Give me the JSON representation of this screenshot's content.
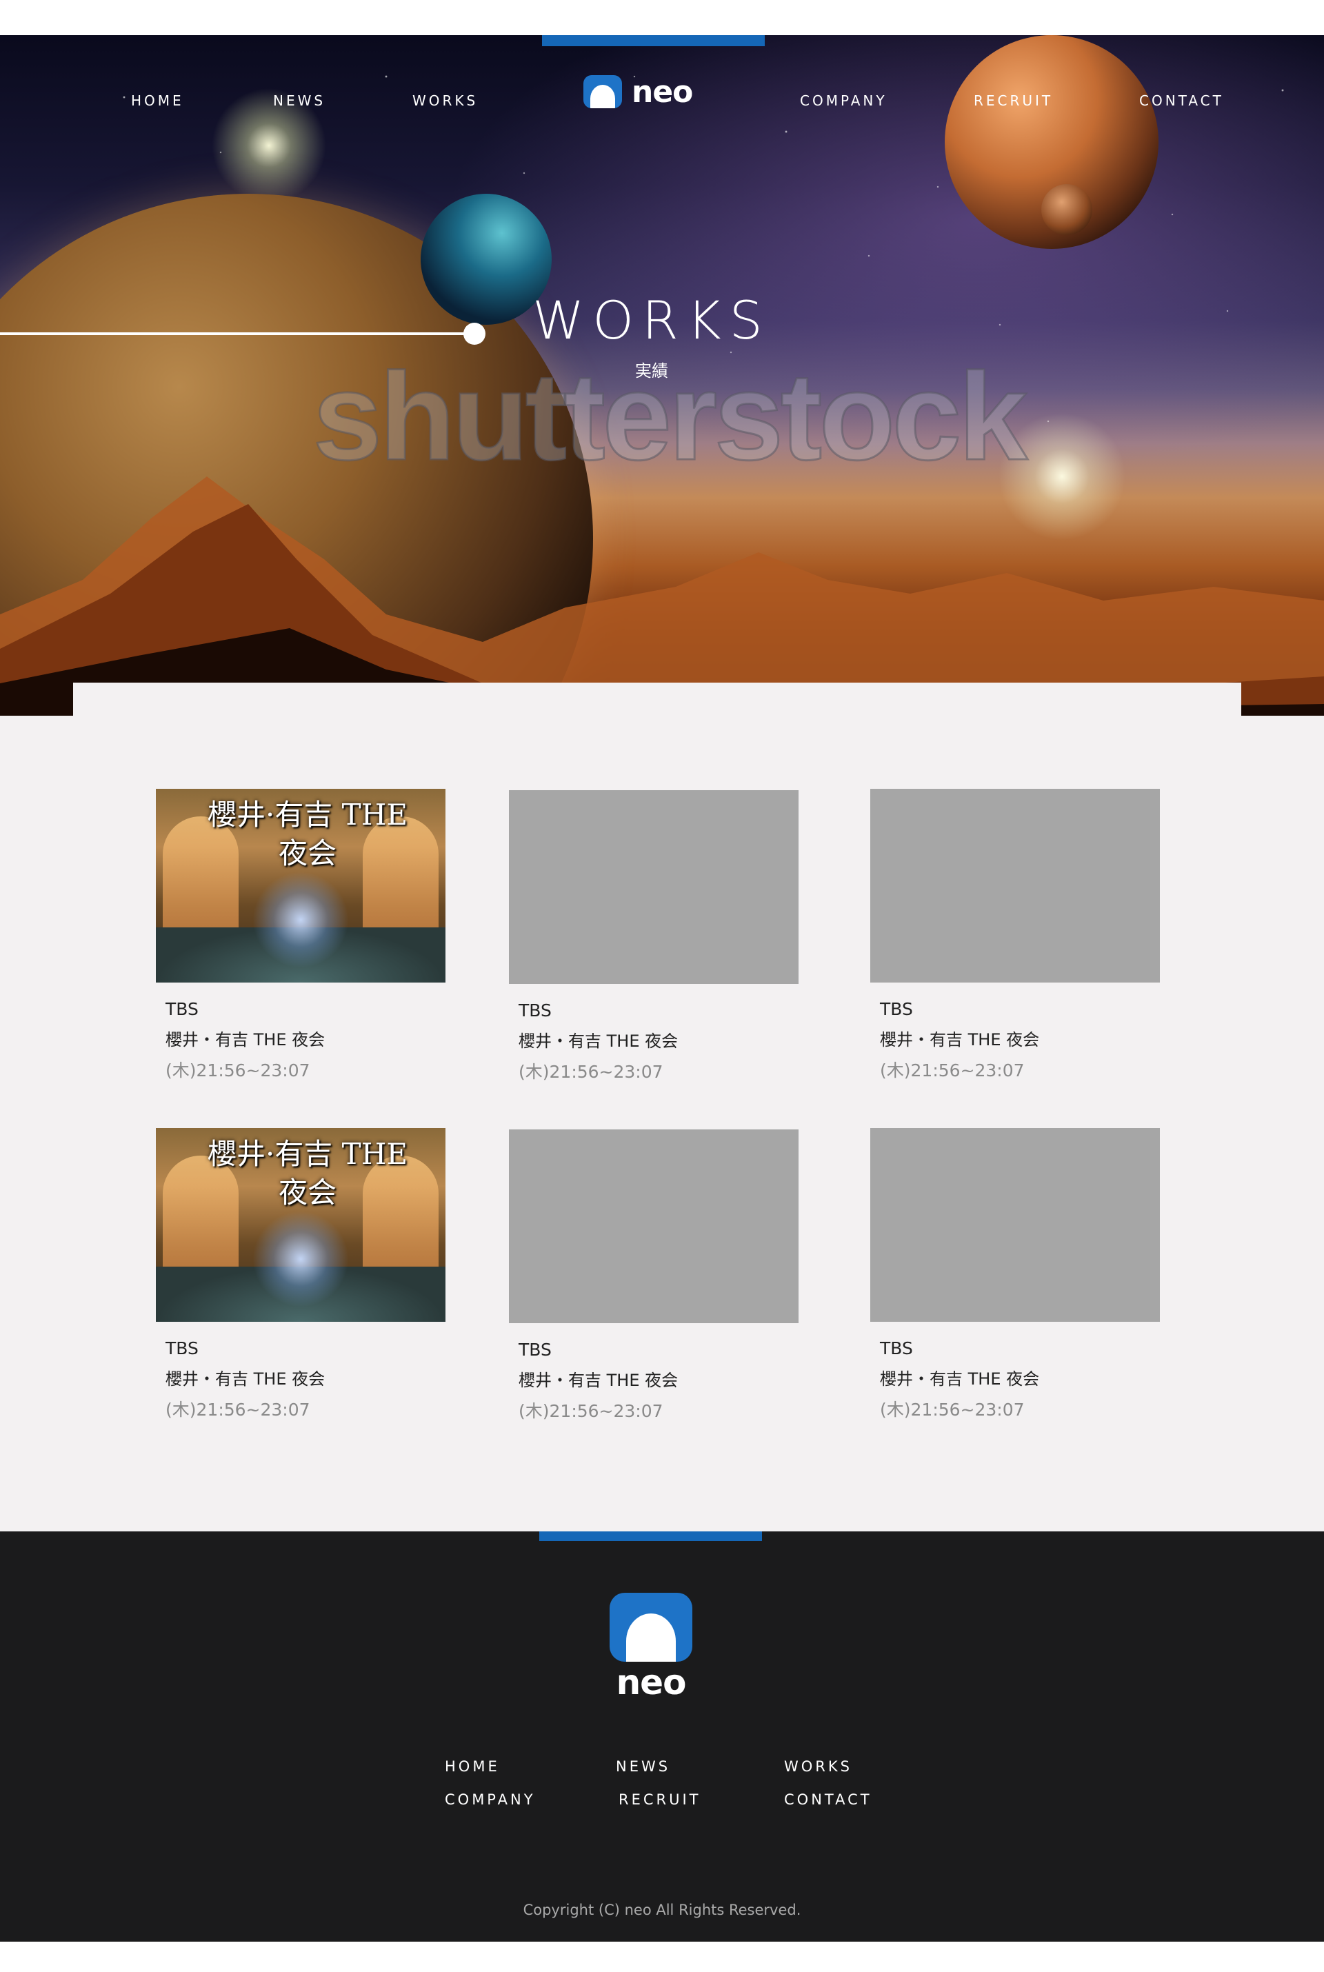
{
  "brand": {
    "logo_text": "neo",
    "accent_color": "#1567b7"
  },
  "nav": {
    "items": [
      {
        "label": "HOME"
      },
      {
        "label": "NEWS"
      },
      {
        "label": "WORKS"
      },
      {
        "label": "COMPANY"
      },
      {
        "label": "RECRUIT"
      },
      {
        "label": "CONTACT"
      }
    ]
  },
  "hero": {
    "title": "WORKS",
    "subtitle": "実績",
    "watermark": "shutterstock"
  },
  "works": {
    "items": [
      {
        "station": "TBS",
        "title": "櫻井・有吉 THE 夜会",
        "time": "(木)21:56~23:07",
        "thumb_text": "櫻井·有吉 THE 夜会",
        "has_image": true
      },
      {
        "station": "TBS",
        "title": "櫻井・有吉 THE 夜会",
        "time": "(木)21:56~23:07",
        "has_image": false
      },
      {
        "station": "TBS",
        "title": "櫻井・有吉 THE 夜会",
        "time": "(木)21:56~23:07",
        "has_image": false
      },
      {
        "station": "TBS",
        "title": "櫻井・有吉 THE 夜会",
        "time": "(木)21:56~23:07",
        "thumb_text": "櫻井·有吉 THE 夜会",
        "has_image": true
      },
      {
        "station": "TBS",
        "title": "櫻井・有吉 THE 夜会",
        "time": "(木)21:56~23:07",
        "has_image": false
      },
      {
        "station": "TBS",
        "title": "櫻井・有吉 THE 夜会",
        "time": "(木)21:56~23:07",
        "has_image": false
      }
    ]
  },
  "footer": {
    "logo_text": "neo",
    "links": [
      {
        "label": "HOME"
      },
      {
        "label": "NEWS"
      },
      {
        "label": "WORKS"
      },
      {
        "label": "COMPANY"
      },
      {
        "label": "RECRUIT"
      },
      {
        "label": "CONTACT"
      }
    ],
    "copyright": "Copyright (C) neo All Rights Reserved."
  }
}
